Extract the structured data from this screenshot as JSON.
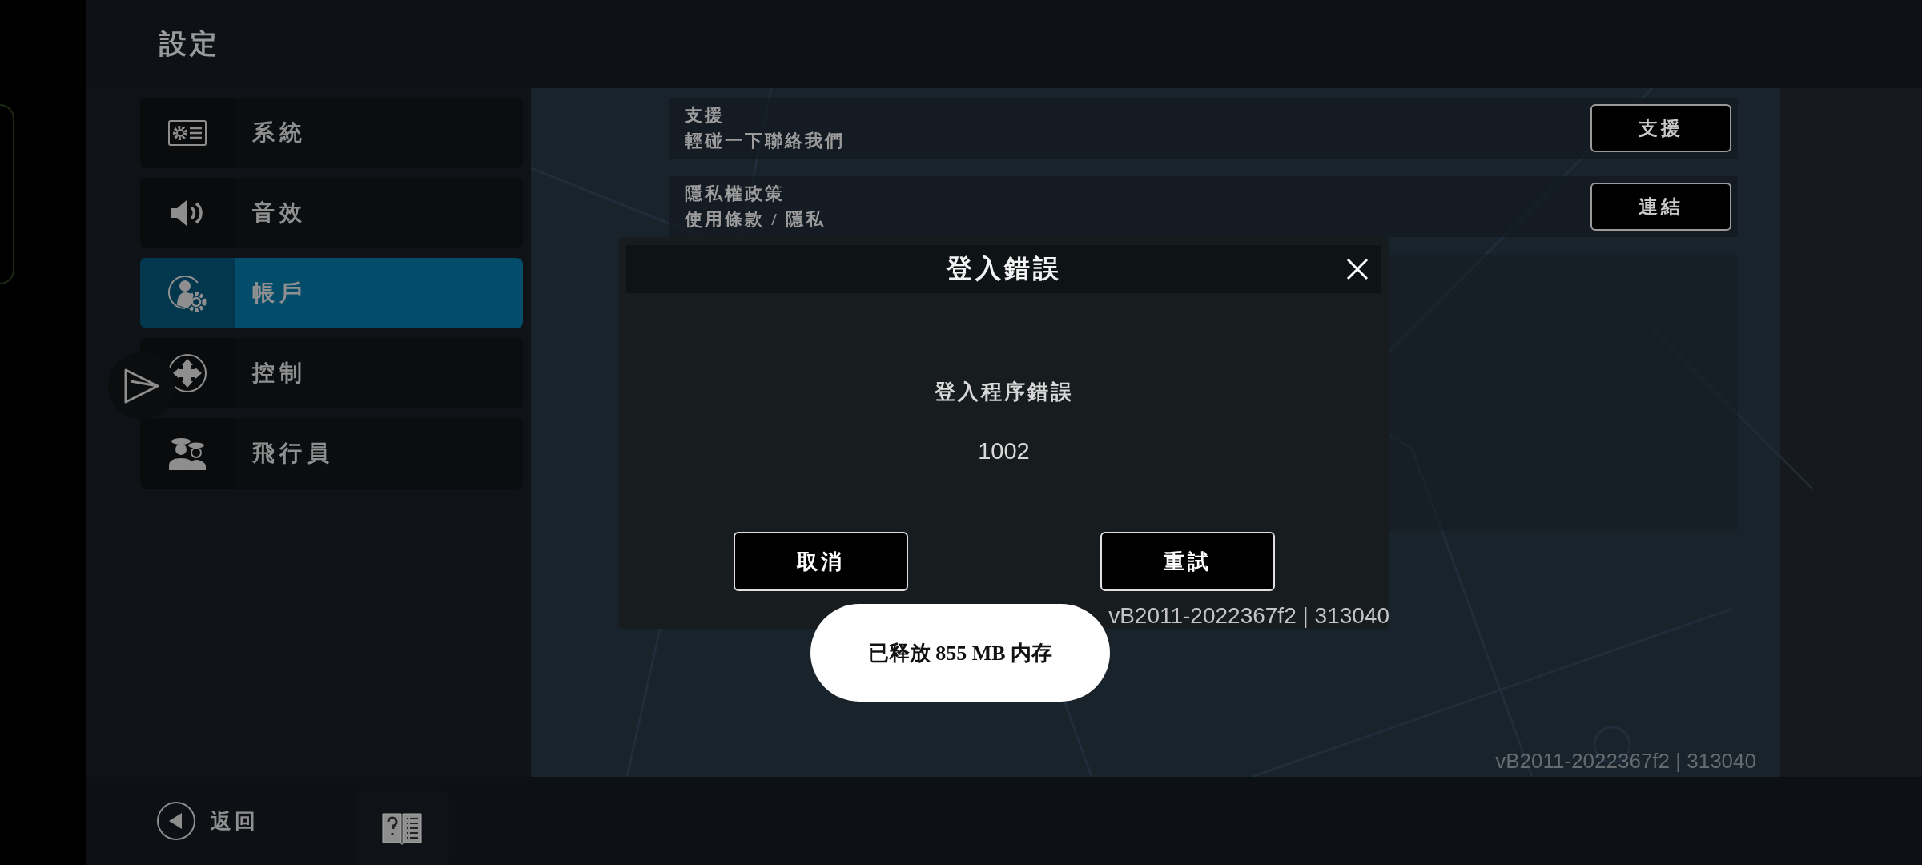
{
  "header": {
    "title": "設定"
  },
  "sidebar": {
    "items": [
      {
        "label": "系統",
        "selected": false
      },
      {
        "label": "音效",
        "selected": false
      },
      {
        "label": "帳戶",
        "selected": true
      },
      {
        "label": "控制",
        "selected": false
      },
      {
        "label": "飛行員",
        "selected": false
      }
    ]
  },
  "settings_rows": [
    {
      "title": "支援",
      "subtitle": "輕碰一下聯絡我們",
      "button": "支援"
    },
    {
      "title": "隱私權政策",
      "subtitle": "使用條款 / 隱私",
      "button": "連結"
    }
  ],
  "version_footer": "vB2011-2022367f2 | 313040",
  "bottom_bar": {
    "back": "返回"
  },
  "dialog": {
    "title": "登入錯誤",
    "message": "登入程序錯誤",
    "code": "1002",
    "buttons": [
      "取消",
      "重試"
    ],
    "version": "vB2011-2022367f2 | 313040"
  },
  "toast": "已释放 855 MB 内存"
}
